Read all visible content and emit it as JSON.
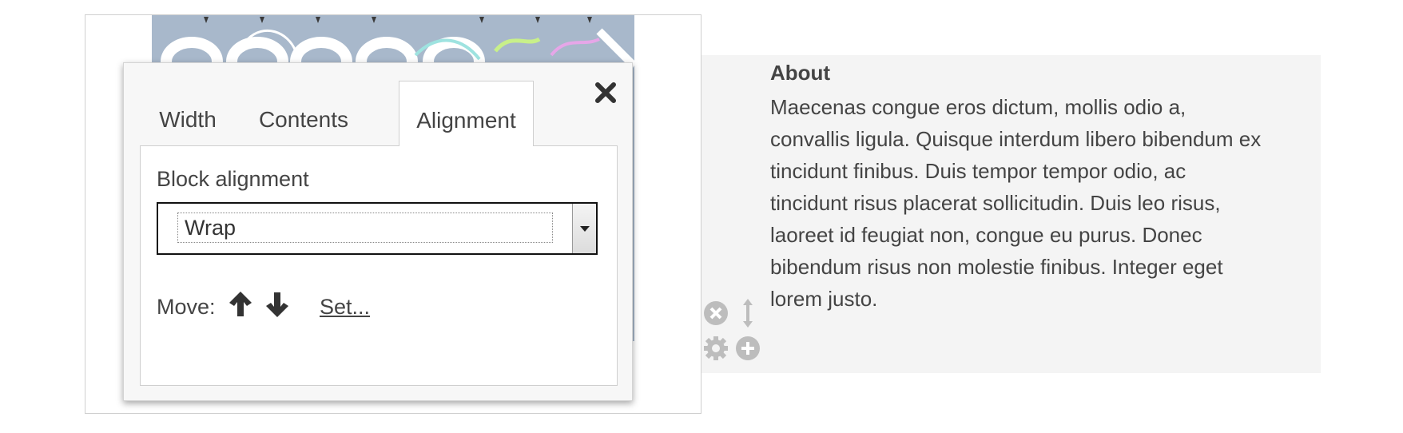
{
  "dialog": {
    "tabs": [
      {
        "label": "Width",
        "active": false
      },
      {
        "label": "Contents",
        "active": false
      },
      {
        "label": "Alignment",
        "active": true
      }
    ],
    "close_icon": "close-icon",
    "block_alignment": {
      "label": "Block alignment",
      "selected": "Wrap"
    },
    "move": {
      "label": "Move:",
      "up_icon": "arrow-up-icon",
      "down_icon": "arrow-down-icon",
      "set_label": "Set..."
    }
  },
  "about": {
    "heading": "About",
    "body": "Maecenas congue eros dictum, mollis odio a, convallis ligula. Quisque interdum libero bibendum ex tincidunt finibus. Duis tempor tempor odio, ac tincidunt risus placerat sollicitudin. Duis leo risus, laoreet id feugiat non, congue eu purus. Donec bibendum risus non molestie finibus. Integer eget lorem justo."
  },
  "block_tools": [
    "remove-icon",
    "move-handle-icon",
    "settings-icon",
    "add-icon"
  ],
  "colors": {
    "panel_bg": "#f4f4f4",
    "tool_icon": "#bdbdbd",
    "text": "#444444"
  }
}
